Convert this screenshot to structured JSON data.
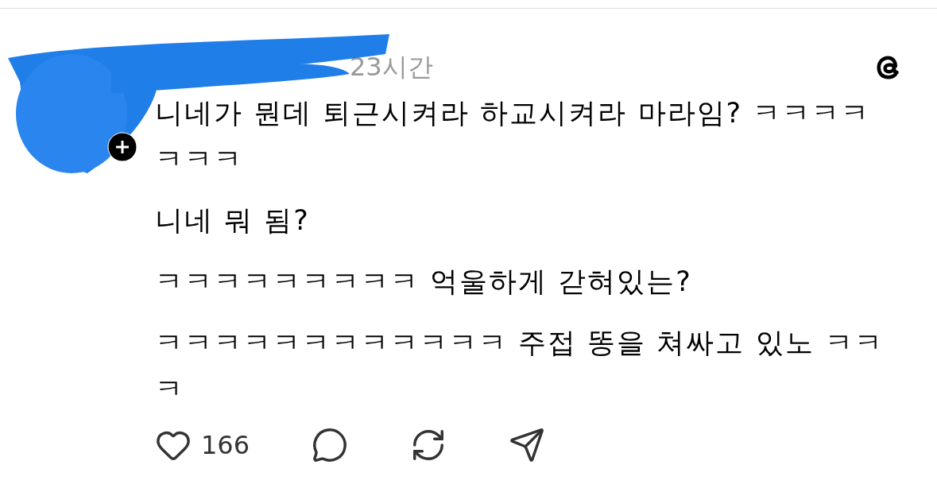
{
  "post": {
    "time": "23시간",
    "paragraphs": [
      "니네가 뭔데 퇴근시켜라 하교시켜라 마라임? ㅋㅋㅋㅋㅋㅋㅋ",
      "니네 뭐 됨?",
      "ㅋㅋㅋㅋㅋㅋㅋㅋㅋ 억울하게 갇혀있는?",
      "ㅋㅋㅋㅋㅋㅋㅋㅋㅋㅋㅋㅋ 주접 똥을 쳐싸고 있노 ㅋㅋㅋ"
    ],
    "like_count": "166"
  }
}
